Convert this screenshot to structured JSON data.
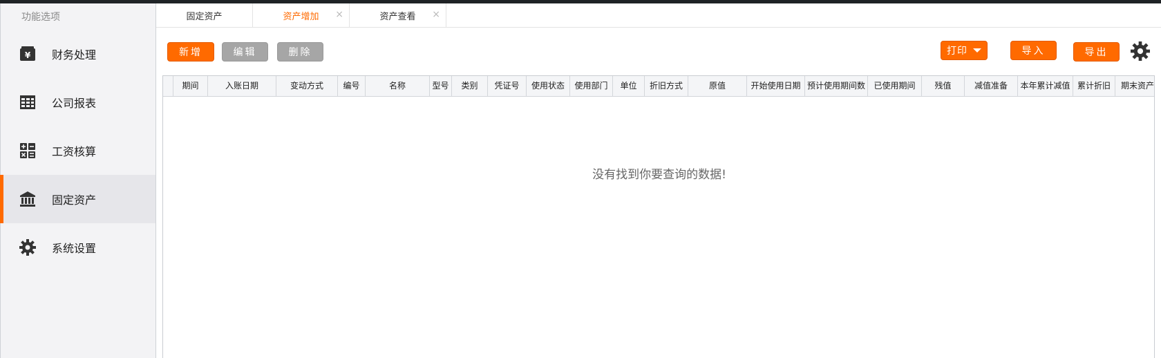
{
  "sidebar": {
    "header": "功能选项",
    "items": [
      {
        "label": "财务处理",
        "icon": "wallet-icon",
        "active": false
      },
      {
        "label": "公司报表",
        "icon": "table-icon",
        "active": false
      },
      {
        "label": "工资核算",
        "icon": "calculator-icon",
        "active": false
      },
      {
        "label": "固定资产",
        "icon": "bank-icon",
        "active": true
      },
      {
        "label": "系统设置",
        "icon": "gear-icon",
        "active": false
      }
    ]
  },
  "tabs": [
    {
      "label": "固定资产",
      "closable": false,
      "active": false
    },
    {
      "label": "资产增加",
      "closable": true,
      "active": true
    },
    {
      "label": "资产查看",
      "closable": true,
      "active": false
    }
  ],
  "tab_close_glyph": "×",
  "toolbar": {
    "add_label": "新增",
    "edit_label": "编辑",
    "delete_label": "删除",
    "print_label": "打印",
    "import_label": "导入",
    "export_label": "导出",
    "settings_icon": "gear-icon"
  },
  "colors": {
    "accent": "#ff6a00",
    "disabled": "#a6a6a6"
  },
  "table": {
    "columns": [
      "",
      "期间",
      "入账日期",
      "变动方式",
      "编号",
      "名称",
      "型号",
      "类别",
      "凭证号",
      "使用状态",
      "使用部门",
      "单位",
      "折旧方式",
      "原值",
      "开始使用日期",
      "预计使用期间数",
      "已使用期间",
      "残值",
      "减值准备",
      "本年累计减值",
      "累计折旧",
      "期末资产"
    ],
    "rows": [],
    "empty_message": "没有找到你要查询的数据!"
  }
}
